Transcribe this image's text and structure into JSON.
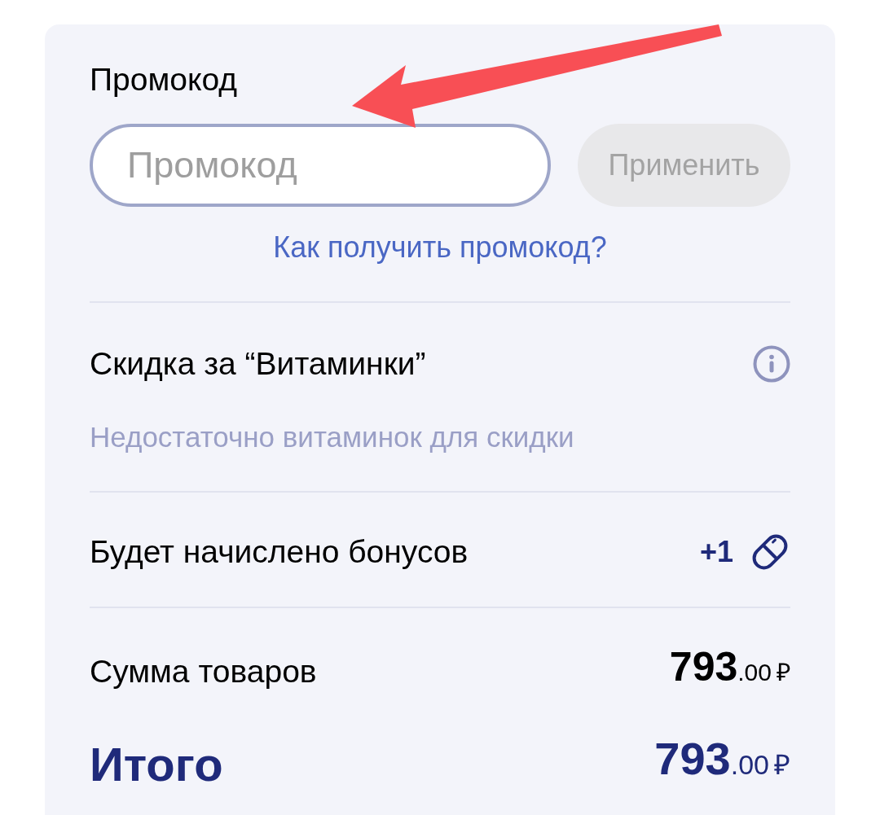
{
  "promo": {
    "label": "Промокод",
    "placeholder": "Промокод",
    "apply_button": {
      "label": "Применить",
      "disabled": true
    },
    "help_link": "Как получить промокод?"
  },
  "rows": [
    {
      "kind": "info",
      "label": "Скидка за “Витаминки”",
      "note": "Недостаточно витаминок для скидки"
    },
    {
      "kind": "bonus",
      "label": "Будет начислено бонусов",
      "value": "+1"
    },
    {
      "kind": "sum",
      "label": "Сумма товаров",
      "amount": "793",
      "decimals": ".00",
      "currency": "₽"
    },
    {
      "kind": "total",
      "label": "Итого",
      "amount": "793",
      "decimals": ".00",
      "currency": "₽"
    }
  ]
}
